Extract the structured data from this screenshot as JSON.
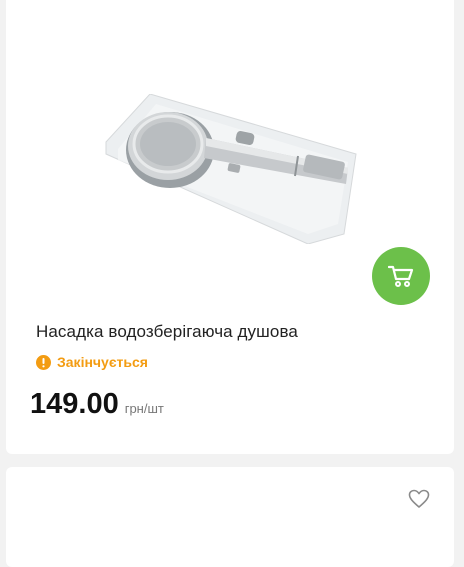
{
  "products": [
    {
      "title": "Насадка водозберігаюча душова",
      "status": "Закінчується",
      "price": "149.00",
      "unit": "грн/шт",
      "image_icon": "shower-head-product-image",
      "cart_icon": "cart-icon"
    },
    {
      "favorite_icon": "heart-icon"
    }
  ],
  "colors": {
    "accent_green": "#6cc04a",
    "status_orange": "#f39c12",
    "background": "#f2f2f2"
  }
}
